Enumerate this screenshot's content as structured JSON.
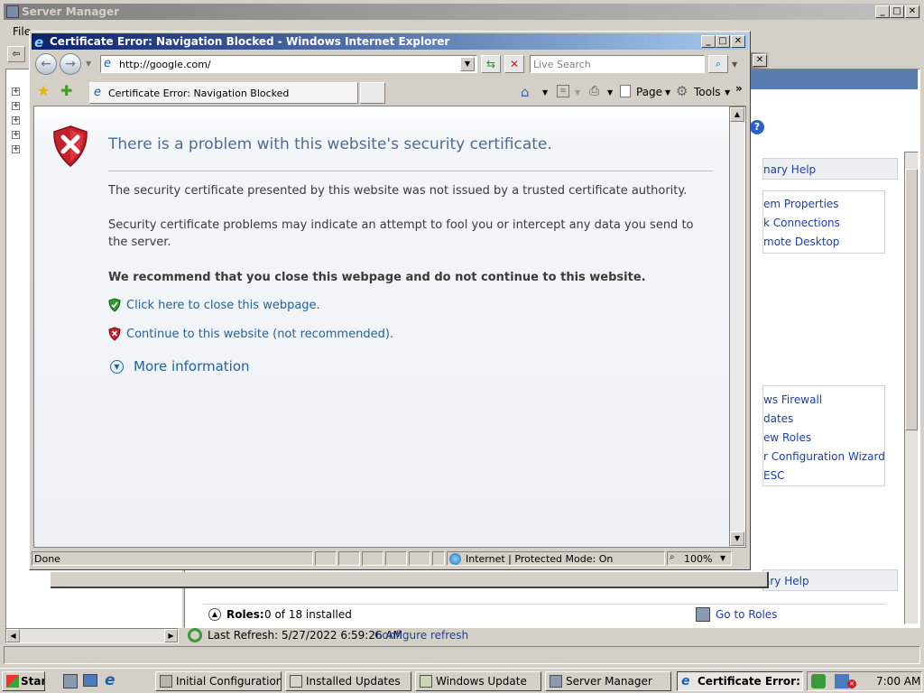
{
  "server_manager": {
    "title": "Server Manager",
    "menu_file": "File",
    "right_links_top": [
      "nary Help",
      "em Properties",
      "k Connections",
      "mote Desktop"
    ],
    "right_links_mid": [
      "ws Firewall",
      "dates",
      "ew Roles",
      "r Configuration Wizard",
      "ESC"
    ],
    "right_link_help2": "ary Help",
    "roles_label": "Roles:",
    "roles_count": "0 of 18 installed",
    "go_to_roles": "Go to Roles",
    "last_refresh": "Last Refresh: 5/27/2022 6:59:26 AM",
    "configure_refresh": "Configure refresh"
  },
  "ie": {
    "title": "Certificate Error: Navigation Blocked - Windows Internet Explorer",
    "address": "http://google.com/",
    "search_placeholder": "Live Search",
    "tab_label": "Certificate Error: Navigation Blocked",
    "toolbar_page": "Page",
    "toolbar_tools": "Tools",
    "heading": "There is a problem with this website's security certificate.",
    "para1": "The security certificate presented by this website was not issued by a trusted certificate authority.",
    "para2": "Security certificate problems may indicate an attempt to fool you or intercept any data you send to the server.",
    "recommend": "We recommend that you close this webpage and do not continue to this website.",
    "close_link": "Click here to close this webpage.",
    "continue_link": "Continue to this website (not recommended).",
    "more_info": "More information",
    "status_done": "Done",
    "status_zone": "Internet | Protected Mode: On",
    "status_zoom": "100%"
  },
  "taskbar": {
    "start": "Start",
    "tasks": [
      "Initial Configuration Ta...",
      "Installed Updates",
      "Windows Update",
      "Server Manager",
      "Certificate Error: ..."
    ],
    "clock": "7:00 AM"
  },
  "colors": {
    "heading": "#4e6c94",
    "link": "#22639e",
    "active_title": "#0a246a",
    "error_red": "#c8202a",
    "ok_green": "#2e9a2e"
  }
}
